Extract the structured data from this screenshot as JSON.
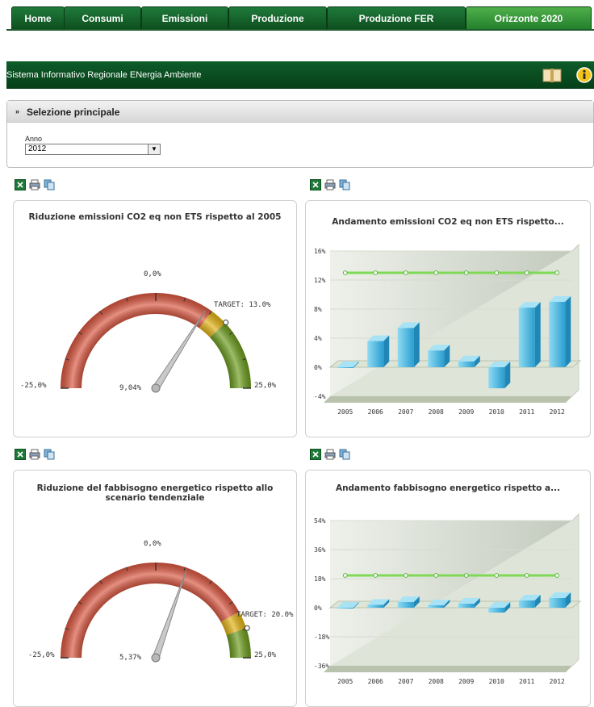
{
  "nav": {
    "tabs": [
      "Home",
      "Consumi",
      "Emissioni",
      "Produzione",
      "Produzione FER",
      "Orizzonte 2020"
    ],
    "active_tab": "Orizzonte 2020"
  },
  "header": {
    "title": "Sistema Informativo Regionale ENergia Ambiente",
    "icons": [
      "book-icon",
      "info-icon"
    ]
  },
  "selection": {
    "heading": "Selezione principale",
    "year_label": "Anno",
    "year_value": "2012"
  },
  "toolbar_icons": [
    "excel-icon",
    "print-icon",
    "copy-icon"
  ],
  "colors": {
    "nav_green": "#0e4f20",
    "active_tab": "#3a9a3c",
    "header_green": "#063f18",
    "gauge_red": "#d9553f",
    "gauge_yellow": "#e2b10f",
    "gauge_green": "#6a9a1a",
    "bar_blue": "#3bb1d8",
    "target_line": "#7ed957"
  },
  "gauges": [
    {
      "title": "Riduzione emissioni CO2 eq non ETS rispetto al 2005",
      "min_label": "-25,0%",
      "max_label": "25,0%",
      "mid_label": "0,0%",
      "value_label": "9,04%",
      "target_label": "TARGET: 13.0%",
      "value": 9.04,
      "target": 13.0,
      "min": -25,
      "max": 25
    },
    {
      "title": "Riduzione del fabbisogno energetico rispetto allo scenario tendenziale",
      "min_label": "-25,0%",
      "max_label": "25,0%",
      "mid_label": "0,0%",
      "value_label": "5,37%",
      "target_label": "TARGET: 20.0%",
      "value": 5.37,
      "target": 20.0,
      "min": -25,
      "max": 25
    }
  ],
  "chart_data": [
    {
      "type": "bar",
      "title": "Andamento emissioni CO2 eq non ETS rispetto...",
      "categories": [
        "2005",
        "2006",
        "2007",
        "2008",
        "2009",
        "2010",
        "2011",
        "2012"
      ],
      "series": [
        {
          "values": [
            0.0,
            3.6,
            5.4,
            2.3,
            0.8,
            -2.9,
            8.2,
            9.0
          ]
        },
        {
          "values": [
            13,
            13,
            13,
            13,
            13,
            13,
            13,
            13
          ]
        }
      ],
      "y_ticks": [
        "16%",
        "12%",
        "8%",
        "4%",
        "0%",
        "-4%"
      ],
      "ylim": [
        -4,
        16
      ],
      "grid": true
    },
    {
      "type": "bar",
      "title": "Andamento fabbisogno energetico rispetto a...",
      "categories": [
        "2005",
        "2006",
        "2007",
        "2008",
        "2009",
        "2010",
        "2011",
        "2012"
      ],
      "series": [
        {
          "values": [
            0.0,
            1.8,
            3.5,
            1.5,
            2.5,
            -3.0,
            4.5,
            6.0
          ]
        },
        {
          "values": [
            20,
            20,
            20,
            20,
            20,
            20,
            20,
            20
          ]
        }
      ],
      "y_ticks": [
        "54%",
        "36%",
        "18%",
        "0%",
        "-18%",
        "-36%"
      ],
      "ylim": [
        -36,
        54
      ],
      "grid": true
    }
  ]
}
